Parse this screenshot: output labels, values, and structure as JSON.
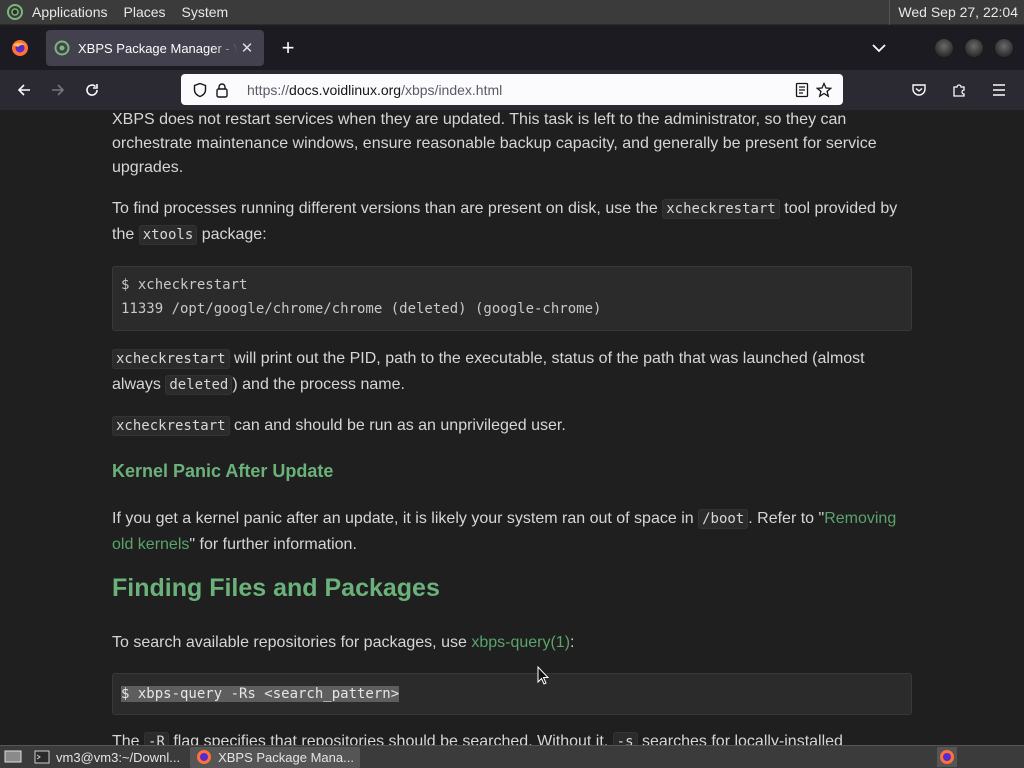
{
  "top_panel": {
    "menus": [
      "Applications",
      "Places",
      "System"
    ],
    "clock": "Wed Sep 27, 22:04"
  },
  "browser": {
    "tab": {
      "title": "XBPS Package Manager - Void Linux Handbook"
    },
    "url": {
      "scheme": "https://",
      "host": "docs.voidlinux.org",
      "path": "/xbps/index.html"
    }
  },
  "article": {
    "p1": "XBPS does not restart services when they are updated. This task is left to the administrator, so they can orchestrate maintenance windows, ensure reasonable backup capacity, and generally be present for service upgrades.",
    "p2_a": "To find processes running different versions than are present on disk, use the ",
    "p2_code1": "xcheckrestart",
    "p2_b": " tool provided by the ",
    "p2_code2": "xtools",
    "p2_c": " package:",
    "code1_line1": "$ xcheckrestart",
    "code1_line2": "11339 /opt/google/chrome/chrome (deleted) (google-chrome)",
    "p3_code": "xcheckrestart",
    "p3_a": " will print out the PID, path to the executable, status of the path that was launched (almost always ",
    "p3_code2": "deleted",
    "p3_b": ") and the process name.",
    "p4_code": "xcheckrestart",
    "p4_a": " can and should be run as an unprivileged user.",
    "h_kernel": "Kernel Panic After Update",
    "p5_a": "If you get a kernel panic after an update, it is likely your system ran out of space in ",
    "p5_code": "/boot",
    "p5_b": ". Refer to \"",
    "p5_link": "Removing old kernels",
    "p5_c": "\" for further information.",
    "h_finding": "Finding Files and Packages",
    "p6_a": "To search available repositories for packages, use ",
    "p6_link": "xbps-query(1)",
    "p6_b": ":",
    "code2": "$ xbps-query -Rs <search_pattern>",
    "p7_a": "The ",
    "p7_code1": "-R",
    "p7_b": " flag specifies that repositories should be searched. Without it, ",
    "p7_code2": "-s",
    "p7_c": " searches for locally-installed"
  },
  "taskbar": {
    "tasks": [
      "vm3@vm3:~/Downl...",
      "XBPS Package Mana..."
    ]
  },
  "colors": {
    "link": "#5aa36b",
    "heading": "#6bb27a",
    "page_bg": "#1f1f1f"
  }
}
